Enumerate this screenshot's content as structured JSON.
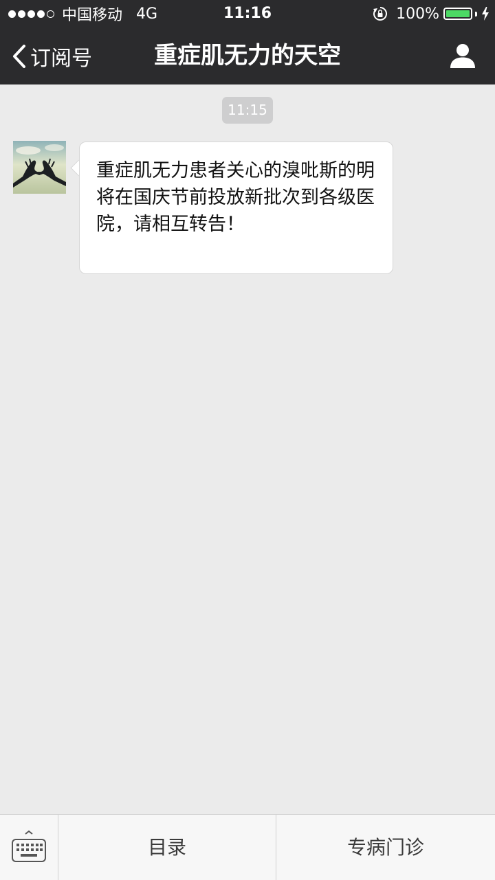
{
  "status_bar": {
    "carrier": "中国移动",
    "network": "4G",
    "time": "11:16",
    "battery_percent": "100%",
    "battery_level": 1.0,
    "signal_bars": 4,
    "signal_max": 5,
    "icons": [
      "signal-dots-icon",
      "rotation-lock-icon",
      "battery-icon",
      "charging-bolt-icon"
    ]
  },
  "nav": {
    "back_label": "订阅号",
    "title": "重症肌无力的天空",
    "icons": [
      "back-chevron-icon",
      "profile-icon"
    ]
  },
  "chat": {
    "timestamp": "11:15",
    "messages": [
      {
        "sender": "incoming",
        "text": "重症肌无力患者关心的溴吡斯的明将在国庆节前投放新批次到各级医院，请相互转告！"
      }
    ]
  },
  "bottom_bar": {
    "keyboard_icon": "keyboard-icon",
    "menu": [
      {
        "label": "目录"
      },
      {
        "label": "专病门诊"
      }
    ]
  },
  "colors": {
    "bar_background": "#2b2b2d",
    "chat_background": "#ebebeb",
    "battery_green": "#4cd964",
    "timestamp_pill": "#cececf"
  }
}
